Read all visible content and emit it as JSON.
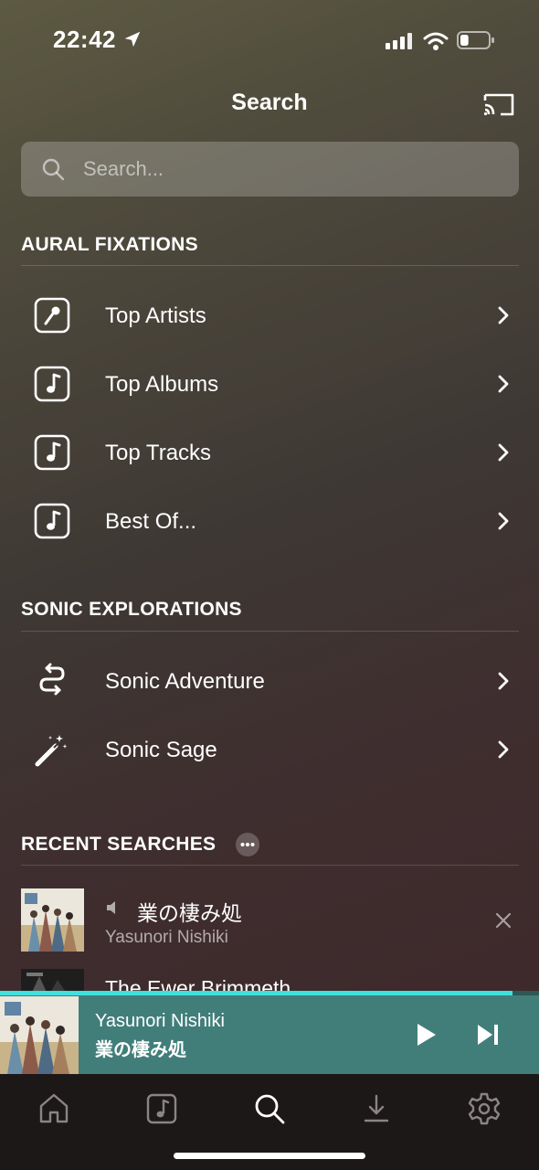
{
  "status_bar": {
    "time": "22:42",
    "battery_level": 0.3
  },
  "header": {
    "title": "Search"
  },
  "search": {
    "placeholder": "Search..."
  },
  "sections": {
    "aural": {
      "title": "AURAL FIXATIONS",
      "items": [
        {
          "label": "Top Artists",
          "icon": "microphone-icon"
        },
        {
          "label": "Top Albums",
          "icon": "music-note-icon"
        },
        {
          "label": "Top Tracks",
          "icon": "music-note-icon"
        },
        {
          "label": "Best Of...",
          "icon": "music-note-icon"
        }
      ]
    },
    "sonic": {
      "title": "SONIC EXPLORATIONS",
      "items": [
        {
          "label": "Sonic Adventure",
          "icon": "route-arrows-icon"
        },
        {
          "label": "Sonic Sage",
          "icon": "magic-wand-icon"
        }
      ]
    },
    "recent": {
      "title": "RECENT SEARCHES",
      "items": [
        {
          "title": "業の棲み処",
          "subtitle": "Yasunori Nishiki"
        },
        {
          "title": "The Ewer Brimmeth"
        }
      ]
    }
  },
  "now_playing": {
    "artist": "Yasunori Nishiki",
    "title": "業の棲み処",
    "progress": 0.95
  },
  "tabs": [
    "home-icon",
    "library-icon",
    "search-icon",
    "downloads-icon",
    "settings-icon"
  ],
  "colors": {
    "accent_progress": "#3fe1df",
    "player_bg": "#417e7a",
    "tab_bar_bg": "#1d1818"
  }
}
